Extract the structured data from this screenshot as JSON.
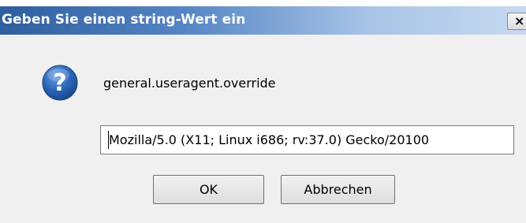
{
  "dialog": {
    "title": "Geben Sie einen string-Wert ein",
    "close_label": "×",
    "preference_name": "general.useragent.override",
    "icon": "question-icon",
    "value_field": {
      "value": "Mozilla/5.0 (X11; Linux i686; rv:37.0) Gecko/20100"
    },
    "buttons": {
      "ok_label": "OK",
      "cancel_label": "Abbrechen"
    }
  },
  "colors": {
    "titlebar_start": "#2f5e9f",
    "titlebar_end": "#c6d9f0",
    "dialog_background": "#f0f0f0",
    "icon_blue": "#2a64b8"
  }
}
